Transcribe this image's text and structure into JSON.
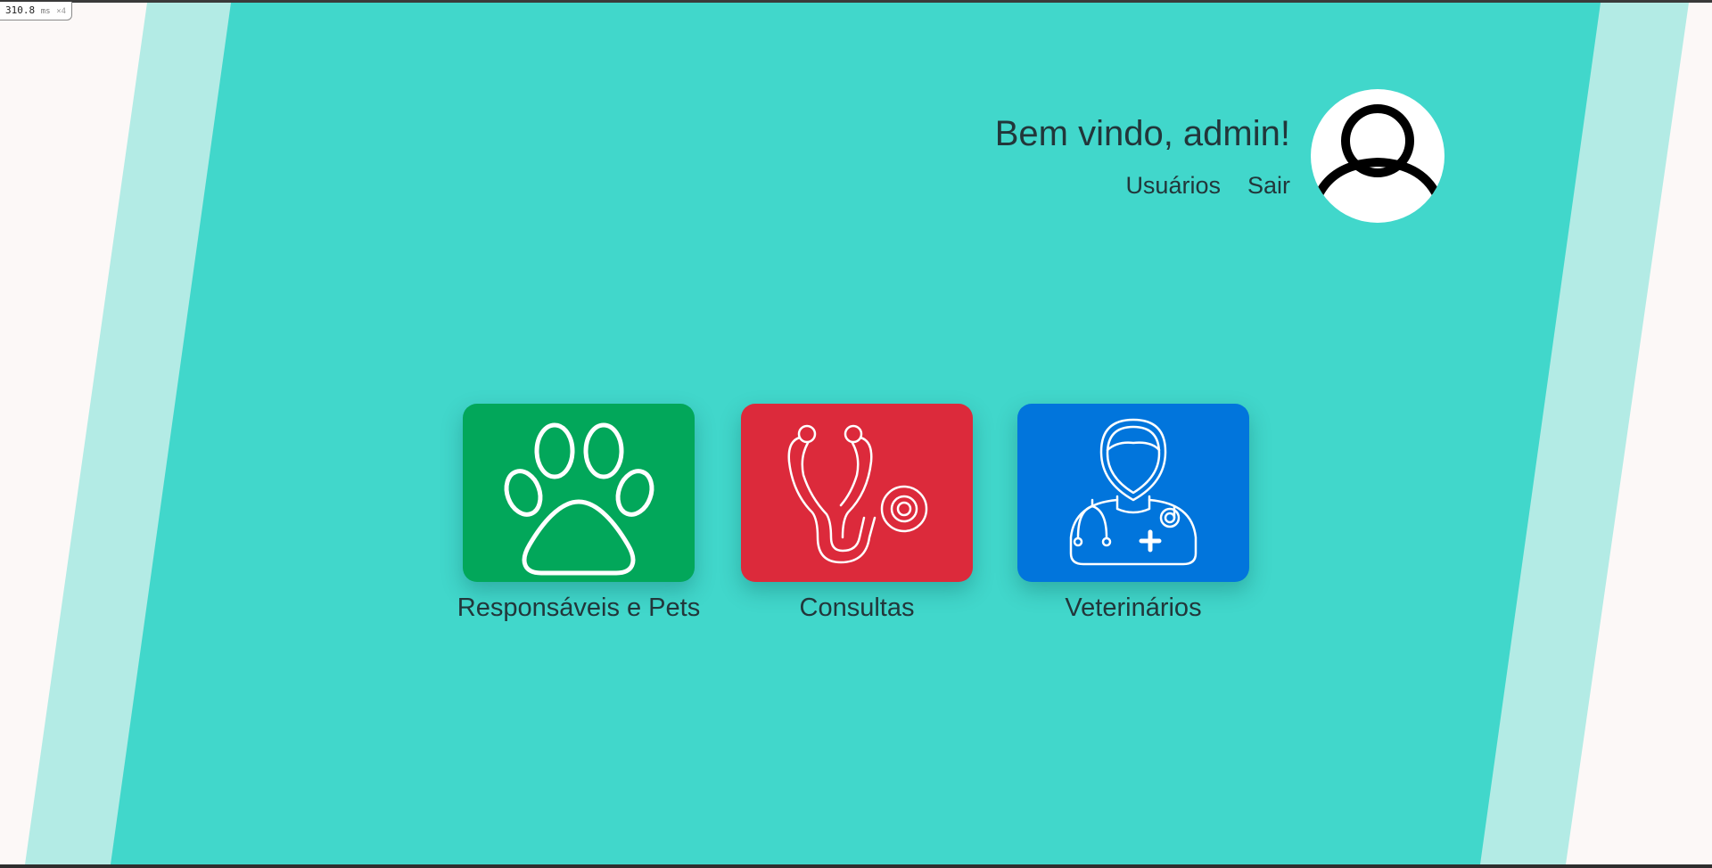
{
  "perf": {
    "value": "310.8",
    "unit": "ms",
    "multiplier": "×4"
  },
  "header": {
    "welcome": "Bem vindo, admin!",
    "links": {
      "users": "Usuários",
      "logout": "Sair"
    },
    "avatar_icon": "user-silhouette-icon"
  },
  "tiles": [
    {
      "label": "Responsáveis e Pets",
      "color": "#02a75a",
      "icon": "paw-icon"
    },
    {
      "label": "Consultas",
      "color": "#dc2a3b",
      "icon": "stethoscope-icon"
    },
    {
      "label": "Veterinários",
      "color": "#0175dc",
      "icon": "veterinarian-icon"
    }
  ],
  "colors": {
    "background": "#fcf8f7",
    "band_light": "#b3ebe5",
    "band_main": "#41d7cb",
    "text": "#22363a"
  }
}
